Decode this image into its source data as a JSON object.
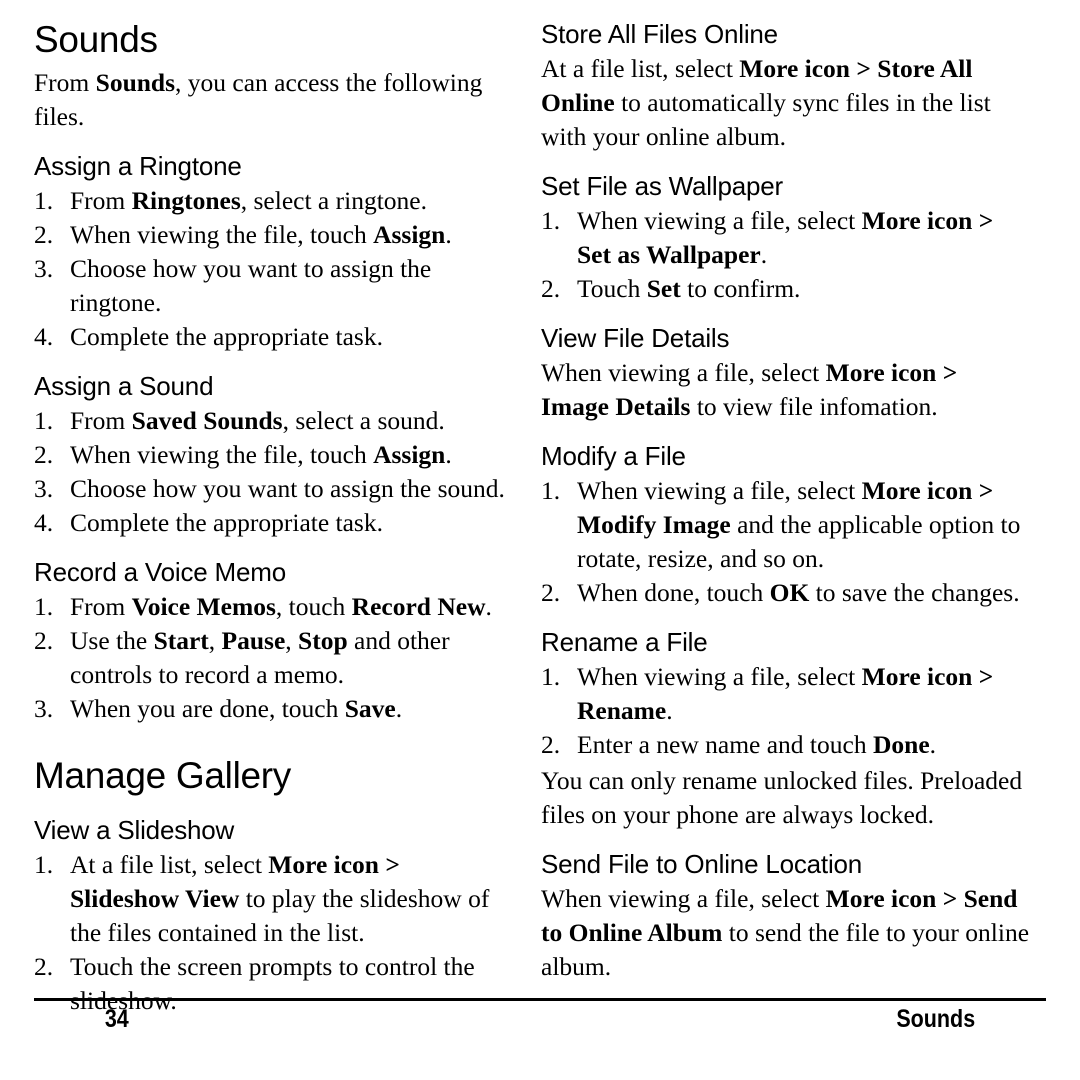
{
  "document": {
    "page_number": "34",
    "footer_section": "Sounds"
  },
  "left_column": {
    "chapter_title": "Sounds",
    "intro": {
      "prefix": "From ",
      "bold1": "Sounds",
      "suffix": ", you can access the following files."
    },
    "sections": [
      {
        "heading": "Assign a Ringtone",
        "steps": [
          {
            "num": "1.",
            "a": "From ",
            "b1": "Ringtones",
            "c": ", select a ringtone."
          },
          {
            "num": "2.",
            "a": "When viewing the file, touch ",
            "b1": "Assign",
            "c": "."
          },
          {
            "num": "3.",
            "a": "Choose how you want to assign the ringtone.",
            "b1": "",
            "c": ""
          },
          {
            "num": "4.",
            "a": "Complete the appropriate task.",
            "b1": "",
            "c": ""
          }
        ]
      },
      {
        "heading": "Assign a Sound",
        "steps": [
          {
            "num": "1.",
            "a": "From ",
            "b1": "Saved Sounds",
            "c": ", select a sound."
          },
          {
            "num": "2.",
            "a": "When viewing the file, touch ",
            "b1": "Assign",
            "c": "."
          },
          {
            "num": "3.",
            "a": "Choose how you want to assign the sound.",
            "b1": "",
            "c": ""
          },
          {
            "num": "4.",
            "a": "Complete the appropriate task.",
            "b1": "",
            "c": ""
          }
        ]
      },
      {
        "heading": "Record a Voice Memo",
        "steps": [
          {
            "num": "1.",
            "a": "From ",
            "b1": "Voice Memos",
            "c": ", touch ",
            "b2": "Record New",
            "d": "."
          },
          {
            "num": "2.",
            "a": "Use the ",
            "b1": "Start",
            "c": ", ",
            "b2": "Pause",
            "d": ", ",
            "b3": "Stop",
            "e": " and other controls to record a memo."
          },
          {
            "num": "3.",
            "a": "When you are done, touch ",
            "b1": "Save",
            "c": "."
          }
        ]
      }
    ],
    "chapter_title_2": "Manage Gallery",
    "sections_2": [
      {
        "heading": "View a Slideshow",
        "steps": [
          {
            "num": "1.",
            "a": "At a file list, select ",
            "b1": "More icon > Slideshow View",
            "c": " to play the slideshow of the files contained in the list."
          },
          {
            "num": "2.",
            "a": "Touch the screen prompts to control the slideshow.",
            "b1": "",
            "c": ""
          }
        ]
      }
    ]
  },
  "right_column": {
    "sections": [
      {
        "heading": "Store All Files Online",
        "paragraph": {
          "a": "At a file list, select ",
          "b1": "More icon > Store All Online",
          "c": " to automatically sync files in the list with your online album."
        },
        "steps": []
      },
      {
        "heading": "Set File as Wallpaper",
        "steps": [
          {
            "num": "1.",
            "a": "When viewing a file, select ",
            "b1": "More icon > Set as Wallpaper",
            "c": "."
          },
          {
            "num": "2.",
            "a": "Touch ",
            "b1": "Set",
            "c": " to confirm."
          }
        ]
      },
      {
        "heading": "View File Details",
        "paragraph": {
          "a": "When viewing a file, select ",
          "b1": "More icon > Image Details",
          "c": " to view file infomation."
        },
        "steps": []
      },
      {
        "heading": "Modify a File",
        "steps": [
          {
            "num": "1.",
            "a": "When viewing a file, select ",
            "b1": "More icon > Modify Image",
            "c": " and the applicable option to rotate, resize, and so on."
          },
          {
            "num": "2.",
            "a": "When done, touch ",
            "b1": "OK",
            "c": " to save the changes."
          }
        ]
      },
      {
        "heading": "Rename a File",
        "steps": [
          {
            "num": "1.",
            "a": "When viewing a file, select ",
            "b1": "More icon > Rename",
            "c": "."
          },
          {
            "num": "2.",
            "a": "Enter a new name and touch ",
            "b1": "Done",
            "c": "."
          }
        ],
        "trailing_paragraph": "You can only rename unlocked files. Preloaded files on your phone are always locked."
      },
      {
        "heading": "Send File to Online Location",
        "paragraph": {
          "a": "When viewing a file, select ",
          "b1": "More icon > Send to Online Album",
          "c": " to send the file to your online album."
        },
        "steps": []
      }
    ]
  }
}
